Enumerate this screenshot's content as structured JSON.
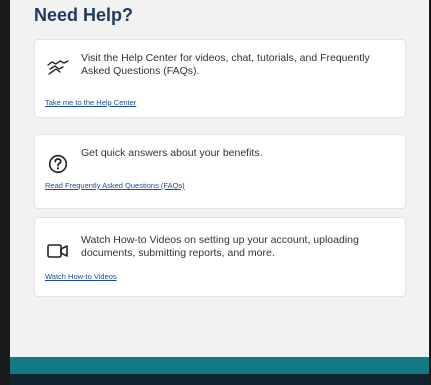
{
  "section": {
    "title": "Need Help?"
  },
  "cards": [
    {
      "icon": "handshake-icon",
      "description": "Visit the Help Center for videos, chat, tutorials, and Frequently Asked Questions (FAQs).",
      "link_label": "Take me to the Help Center"
    },
    {
      "icon": "question-circle-icon",
      "description": "Get quick answers about your benefits.",
      "link_label": "Read Frequently Asked Questions (FAQs)"
    },
    {
      "icon": "video-camera-icon",
      "description": "Watch How-to Videos on setting up your account, uploading documents, submitting reports, and more.",
      "link_label": "Watch How-to Videos"
    }
  ],
  "colors": {
    "heading": "#1f3a5f",
    "link": "#1a4fa0",
    "footer_teal": "#127a84",
    "footer_dark": "#0f2430"
  }
}
